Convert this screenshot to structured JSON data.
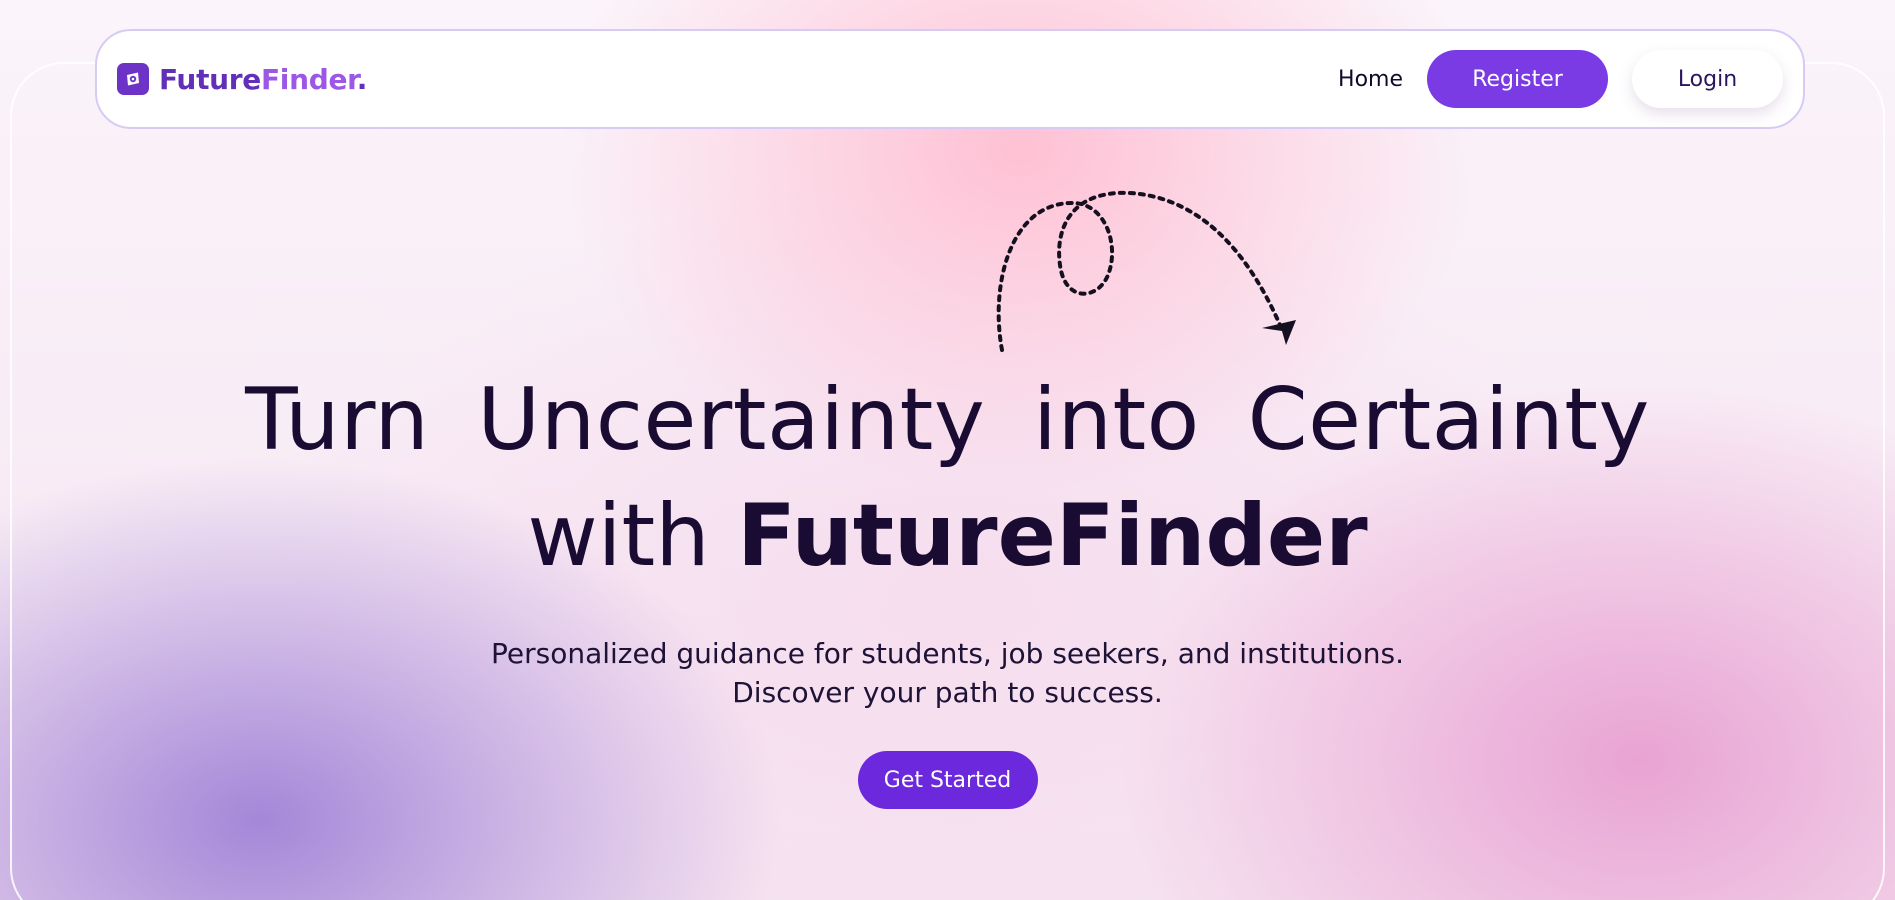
{
  "brand": {
    "name_part1": "Future",
    "name_part2": "Finder",
    "name_suffix": ".",
    "logo_icon": "compass-logo-icon"
  },
  "nav": {
    "home_label": "Home",
    "register_label": "Register",
    "login_label": "Login"
  },
  "hero": {
    "headline_line1": "Turn Uncertainty into Certainty",
    "headline_line2_prefix": "with",
    "headline_line2_emphasis": "FutureFinder",
    "subtitle_line1": "Personalized guidance for students, job seekers, and institutions.",
    "subtitle_line2": "Discover your path to success.",
    "cta_label": "Get Started",
    "decoration_icon": "dotted-loop-arrow-icon"
  },
  "colors": {
    "accent": "#7a3ae4",
    "cta": "#6c28dc",
    "brand_dark": "#6230b8",
    "brand_light": "#9c57e6",
    "text_dark": "#1a0b33",
    "nav_border": "#d6cbf5"
  }
}
